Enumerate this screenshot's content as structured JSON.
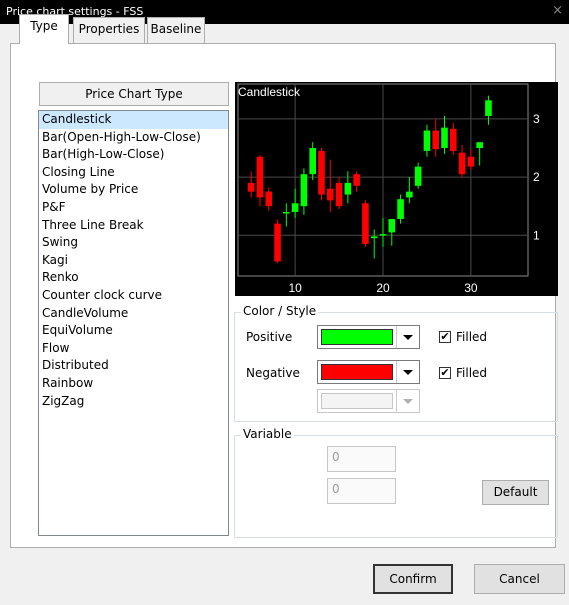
{
  "window": {
    "title": "Price chart settings - FSS",
    "close_glyph": "×"
  },
  "tabs": [
    {
      "label": "Type",
      "active": true
    },
    {
      "label": "Properties",
      "active": false
    },
    {
      "label": "Baseline",
      "active": false
    }
  ],
  "list_header": "Price Chart Type",
  "chart_types": [
    "Candlestick",
    "Bar(Open-High-Low-Close)",
    "Bar(High-Low-Close)",
    "Closing Line",
    "Volume by Price",
    "P&F",
    "Three Line Break",
    "Swing",
    "Kagi",
    "Renko",
    "Counter clock curve",
    "CandleVolume",
    "EquiVolume",
    "Flow",
    "Distributed",
    "Rainbow",
    "ZigZag"
  ],
  "selected_index": 0,
  "preview": {
    "title": "Candlestick"
  },
  "color_style": {
    "legend": "Color / Style",
    "positive_label": "Positive",
    "negative_label": "Negative",
    "positive_color": "#00ff00",
    "negative_color": "#ff0000",
    "filled_label": "Filled",
    "positive_filled": true,
    "negative_filled": true,
    "check_glyph": "✔"
  },
  "variable": {
    "legend": "Variable",
    "value1": "0",
    "value2": "0",
    "default_label": "Default"
  },
  "buttons": {
    "confirm": "Confirm",
    "cancel": "Cancel"
  },
  "chart_data": {
    "type": "candlestick",
    "title": "Candlestick",
    "x_ticks": [
      10,
      20,
      30
    ],
    "y_ticks": [
      1,
      2,
      3
    ],
    "xlim": [
      3.5,
      36.5
    ],
    "ylim": [
      0.3,
      3.6
    ],
    "up_color": "#00ff00",
    "down_color": "#ff0000",
    "candles": [
      {
        "x": 5,
        "open": 1.9,
        "high": 2.1,
        "close": 1.75,
        "low": 1.65
      },
      {
        "x": 6,
        "open": 2.35,
        "high": 2.38,
        "close": 1.65,
        "low": 1.5
      },
      {
        "x": 7,
        "open": 1.75,
        "high": 1.82,
        "close": 1.5,
        "low": 1.42
      },
      {
        "x": 8,
        "open": 1.2,
        "high": 1.27,
        "close": 0.55,
        "low": 0.52
      },
      {
        "x": 9,
        "open": 1.4,
        "high": 1.55,
        "close": 1.4,
        "low": 1.15
      },
      {
        "x": 10,
        "open": 1.4,
        "high": 1.8,
        "close": 1.55,
        "low": 1.3
      },
      {
        "x": 11,
        "open": 1.5,
        "high": 2.15,
        "close": 2.05,
        "low": 1.35
      },
      {
        "x": 12,
        "open": 2.05,
        "high": 2.6,
        "close": 2.5,
        "low": 1.95
      },
      {
        "x": 13,
        "open": 2.45,
        "high": 2.5,
        "close": 1.7,
        "low": 1.6
      },
      {
        "x": 14,
        "open": 1.8,
        "high": 2.3,
        "close": 1.6,
        "low": 1.4
      },
      {
        "x": 15,
        "open": 1.9,
        "high": 2.0,
        "close": 1.5,
        "low": 1.45
      },
      {
        "x": 16,
        "open": 1.7,
        "high": 2.1,
        "close": 1.9,
        "low": 1.55
      },
      {
        "x": 17,
        "open": 2.05,
        "high": 2.1,
        "close": 1.85,
        "low": 1.75
      },
      {
        "x": 18,
        "open": 1.55,
        "high": 1.6,
        "close": 0.85,
        "low": 0.8
      },
      {
        "x": 19,
        "open": 0.95,
        "high": 1.1,
        "close": 0.98,
        "low": 0.6
      },
      {
        "x": 20,
        "open": 1.0,
        "high": 1.3,
        "close": 1.02,
        "low": 0.8
      },
      {
        "x": 21,
        "open": 1.05,
        "high": 1.15,
        "close": 1.28,
        "low": 0.82
      },
      {
        "x": 22,
        "open": 1.28,
        "high": 1.7,
        "close": 1.62,
        "low": 1.2
      },
      {
        "x": 23,
        "open": 1.65,
        "high": 2.0,
        "close": 1.75,
        "low": 1.55
      },
      {
        "x": 24,
        "open": 1.85,
        "high": 2.25,
        "close": 2.18,
        "low": 1.8
      },
      {
        "x": 25,
        "open": 2.45,
        "high": 2.9,
        "close": 2.8,
        "low": 2.35
      },
      {
        "x": 26,
        "open": 2.8,
        "high": 3.0,
        "close": 2.48,
        "low": 2.35
      },
      {
        "x": 27,
        "open": 2.5,
        "high": 3.05,
        "close": 2.85,
        "low": 2.4
      },
      {
        "x": 28,
        "open": 2.83,
        "high": 2.93,
        "close": 2.45,
        "low": 2.38
      },
      {
        "x": 29,
        "open": 2.42,
        "high": 2.55,
        "close": 2.05,
        "low": 2.0
      },
      {
        "x": 30,
        "open": 2.35,
        "high": 2.48,
        "close": 2.18,
        "low": 2.12
      },
      {
        "x": 31,
        "open": 2.5,
        "high": 2.55,
        "close": 2.6,
        "low": 2.2
      },
      {
        "x": 32,
        "open": 3.05,
        "high": 3.4,
        "close": 3.32,
        "low": 2.9
      }
    ]
  }
}
